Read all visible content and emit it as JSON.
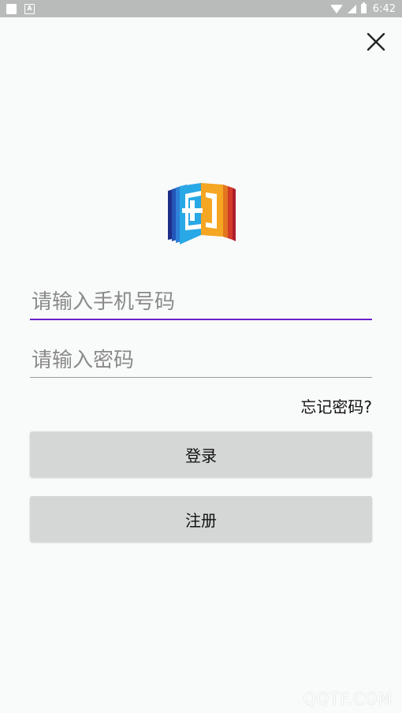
{
  "status_bar": {
    "time": "6:42",
    "left_icons": [
      "notification-square-icon",
      "notification-a-icon"
    ],
    "right_icons": [
      "wifi-icon",
      "signal-icon",
      "battery-icon"
    ]
  },
  "close": {
    "icon": "close-icon"
  },
  "logo": {
    "icon": "book-plus-logo-icon"
  },
  "login_form": {
    "phone_placeholder": "请输入手机号码",
    "phone_value": "",
    "password_placeholder": "请输入密码",
    "password_value": "",
    "forgot_label": "忘记密码?",
    "login_label": "登录",
    "register_label": "注册"
  },
  "colors": {
    "background": "#f9fafa",
    "accent_underline": "#6a1fc9",
    "button_bg": "#d5d7d6",
    "status_bar_bg": "#b9bbbb"
  },
  "watermark": "QQTF.COM"
}
